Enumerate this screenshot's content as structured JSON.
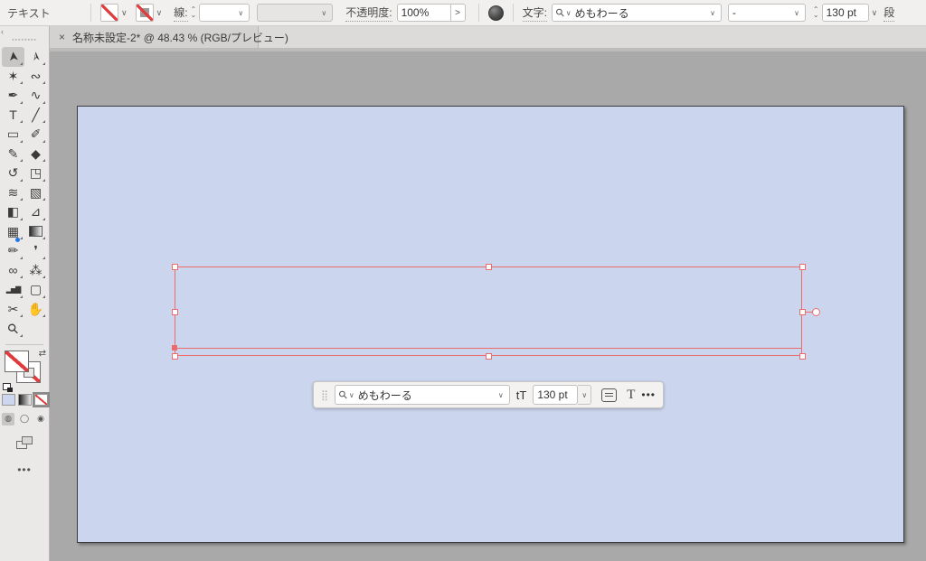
{
  "topbar": {
    "context_label": "テキスト",
    "stroke_label": "線:",
    "opacity_label": "不透明度:",
    "opacity_value": "100%",
    "opacity_expand": ">",
    "character_label": "文字:",
    "font_search_value": "めもわーる",
    "font_style_value": "-",
    "font_size_value": "130 pt",
    "paragraph_label": "段"
  },
  "tabbar": {
    "close": "×",
    "title": "名称未設定-2* @ 48.43 % (RGB/プレビュー)"
  },
  "toolbar": {
    "collapse": "‹",
    "grip": "▪▪▪▪▪▪▪▪",
    "swap_icon": "⇄",
    "more": "•••",
    "tools": [
      {
        "name": "selection",
        "glyph": "➤",
        "selected": true
      },
      {
        "name": "direct-selection",
        "glyph": "➢",
        "selected": false
      },
      {
        "name": "magic-wand",
        "glyph": "✶",
        "selected": false
      },
      {
        "name": "lasso",
        "glyph": "∾",
        "selected": false
      },
      {
        "name": "pen",
        "glyph": "✒",
        "selected": false
      },
      {
        "name": "curvature",
        "glyph": "∿",
        "selected": false
      },
      {
        "name": "type",
        "glyph": "T",
        "selected": false
      },
      {
        "name": "line-segment",
        "glyph": "╱",
        "selected": false
      },
      {
        "name": "rectangle",
        "glyph": "▭",
        "selected": false
      },
      {
        "name": "paintbrush",
        "glyph": "✐",
        "selected": false
      },
      {
        "name": "pencil",
        "glyph": "✎",
        "selected": false
      },
      {
        "name": "eraser",
        "glyph": "◆",
        "selected": false
      },
      {
        "name": "rotate",
        "glyph": "↺",
        "selected": false
      },
      {
        "name": "scale",
        "glyph": "◳",
        "selected": false
      },
      {
        "name": "width",
        "glyph": "≋",
        "selected": false
      },
      {
        "name": "free-transform",
        "glyph": "▧",
        "selected": false
      },
      {
        "name": "shape-builder",
        "glyph": "◧",
        "selected": false
      },
      {
        "name": "perspective-grid",
        "glyph": "⊿",
        "selected": false
      },
      {
        "name": "mesh",
        "glyph": "▦",
        "selected": false
      },
      {
        "name": "gradient",
        "glyph": "",
        "selected": false
      },
      {
        "name": "shaper",
        "glyph": "✏",
        "selected": false
      },
      {
        "name": "eyedropper",
        "glyph": "❜",
        "selected": false
      },
      {
        "name": "blend",
        "glyph": "∞",
        "selected": false
      },
      {
        "name": "symbol-sprayer",
        "glyph": "⁂",
        "selected": false
      },
      {
        "name": "column-graph",
        "glyph": "▂▅▇",
        "selected": false
      },
      {
        "name": "artboard",
        "glyph": "▢",
        "selected": false
      },
      {
        "name": "slice",
        "glyph": "✂",
        "selected": false
      },
      {
        "name": "hand",
        "glyph": "✋",
        "selected": false
      },
      {
        "name": "zoom",
        "glyph": "⚲",
        "selected": false
      }
    ],
    "modes": [
      "◍",
      "◯",
      "◉"
    ]
  },
  "float_bar": {
    "grip_icon": "⣿",
    "font_search_value": "めもわーる",
    "size_icon": "tT",
    "font_size_value": "130 pt",
    "more": "•••"
  },
  "colors": {
    "selection_accent": "#ec6b6b",
    "artboard_fill": "#cbd6ee",
    "canvas_gray": "#a9a9a9",
    "topbar_bg": "#f1f0ef",
    "none_indicator_red": "#e23b3b",
    "shaper_dot_blue": "#1f78f0"
  }
}
